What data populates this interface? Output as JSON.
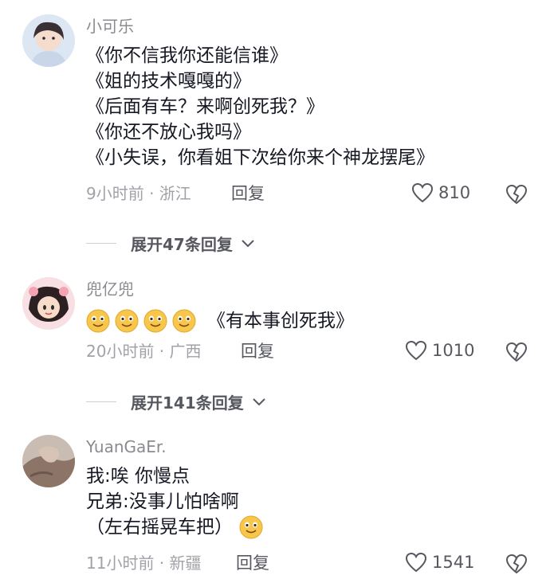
{
  "comments": [
    {
      "username": "小可乐",
      "lines": [
        "《你不信我你还能信谁》",
        "《姐的技术嘎嘎的》",
        "《后面有车？来啊创死我？》",
        "《你还不放心我吗》",
        "《小失误，你看姐下次给你来个神龙摆尾》"
      ],
      "meta": "9小时前 · 浙江",
      "reply_label": "回复",
      "likes": "810",
      "expand": "展开47条回复"
    },
    {
      "username": "兜亿兜",
      "emoji_count": 4,
      "text": "《有本事创死我》",
      "meta": "20小时前 · 广西",
      "reply_label": "回复",
      "likes": "1010",
      "expand": "展开141条回复"
    },
    {
      "username": "YuanGaEr.",
      "lines": [
        "我:唉 你慢点",
        "兄弟:没事儿怕啥啊",
        "（左右摇晃车把）"
      ],
      "meta": "11小时前 · 新疆",
      "reply_label": "回复",
      "likes": "1541"
    }
  ],
  "colors": {
    "text": "#161823",
    "secondary": "#8a8b91",
    "meta": "#a1a2a8",
    "emoji": "#f7c64a"
  },
  "icons": [
    "heart-outline-icon",
    "broken-heart-icon",
    "chevron-down-icon",
    "smile-emoji-icon"
  ]
}
